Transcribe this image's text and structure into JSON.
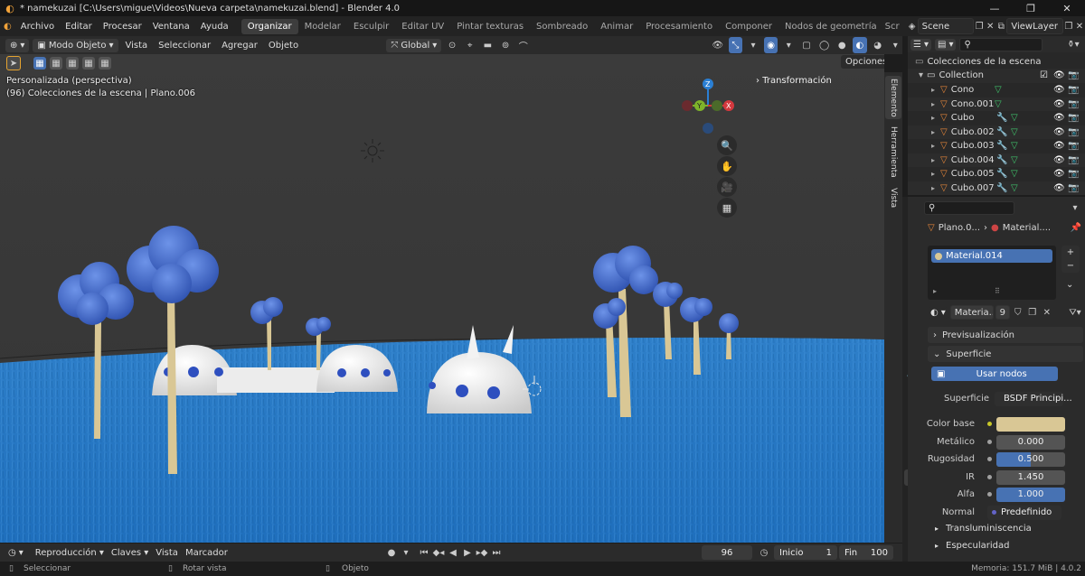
{
  "title_bar": {
    "title": "* namekuzai [C:\\Users\\migue\\Videos\\Nueva carpeta\\namekuzai.blend] - Blender 4.0",
    "logo_glyph": "◐",
    "min_glyph": "—",
    "max_glyph": "❐",
    "close_glyph": "✕"
  },
  "menu": {
    "items": [
      "Archivo",
      "Editar",
      "Procesar",
      "Ventana",
      "Ayuda"
    ]
  },
  "workspaces": {
    "tabs": [
      "Organizar",
      "Modelar",
      "Esculpir",
      "Editar UV",
      "Pintar texturas",
      "Sombreado",
      "Animar",
      "Procesamiento",
      "Componer",
      "Nodos de geometría",
      "Scr"
    ],
    "active": "Organizar"
  },
  "scene": {
    "label": "Scene",
    "viewlayer": "ViewLayer"
  },
  "viewport_header": {
    "mode": "Modo Objeto",
    "menu": [
      "Vista",
      "Seleccionar",
      "Agregar",
      "Objeto"
    ],
    "orientation": "Global",
    "options": "Opciones"
  },
  "viewport": {
    "view_label": "Personalizada (perspectiva)",
    "collection_info": "(96) Colecciones de la escena | Plano.006",
    "transform_panel": "Transformación",
    "gizmo": {
      "z": "Z",
      "y": "Y",
      "x": "X"
    },
    "tools": [
      "🔍",
      "✋",
      "🎥",
      "▦"
    ]
  },
  "side_tabs": [
    "Elemento",
    "Herramienta",
    "Vista"
  ],
  "outliner": {
    "root": "Colecciones de la escena",
    "collection": "Collection",
    "items": [
      {
        "name": "Cono"
      },
      {
        "name": "Cono.001"
      },
      {
        "name": "Cubo"
      },
      {
        "name": "Cubo.002"
      },
      {
        "name": "Cubo.003"
      },
      {
        "name": "Cubo.004"
      },
      {
        "name": "Cubo.005"
      },
      {
        "name": "Cubo.007"
      }
    ]
  },
  "properties": {
    "breadcrumb_obj": "Plano.0...",
    "breadcrumb_mat": "Material....",
    "slot": "Material.014",
    "material_name": "Materia...",
    "users": "9",
    "sections": {
      "preview": "Previsualización",
      "surface": "Superficie",
      "translucency": "Transluminiscencia",
      "specular": "Especularidad"
    },
    "use_nodes": "Usar nodos",
    "surface_label": "Superficie",
    "surface_value": "BSDF Principi...",
    "fields": [
      {
        "label": "Color base",
        "value": ""
      },
      {
        "label": "Metálico",
        "value": "0.000"
      },
      {
        "label": "Rugosidad",
        "value": "0.500"
      },
      {
        "label": "IR",
        "value": "1.450"
      },
      {
        "label": "Alfa",
        "value": "1.000"
      },
      {
        "label": "Normal",
        "value": "Predefinido"
      }
    ],
    "roughness_fraction": 0.5,
    "colors": {
      "base_color": "#d9c795",
      "accent": "#4772b3"
    }
  },
  "timeline": {
    "menu": [
      "Reproducción",
      "Claves",
      "Vista",
      "Marcador"
    ],
    "current_frame": "96",
    "start_label": "Inicio",
    "start": "1",
    "end_label": "Fin",
    "end": "100"
  },
  "status": {
    "select": "Seleccionar",
    "rotate": "Rotar vista",
    "object": "Objeto",
    "memory": "Memoria: 151.7 MiB | 4.0.2"
  }
}
